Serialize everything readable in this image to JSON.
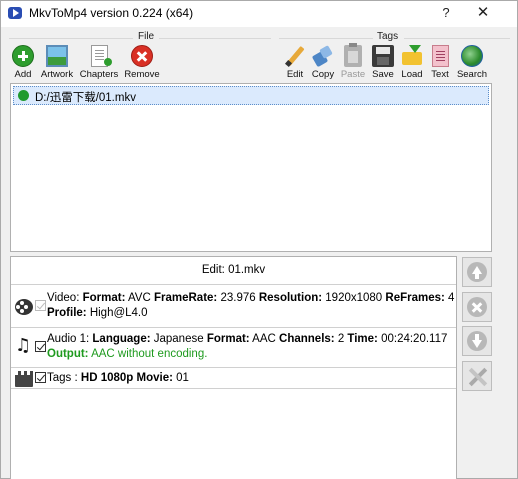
{
  "window": {
    "title": "MkvToMp4 version 0.224 (x64)",
    "help_label": "?",
    "close_label": "✕"
  },
  "toolbar": {
    "file_group_label": "File",
    "tags_group_label": "Tags",
    "add_label": "Add",
    "artwork_label": "Artwork",
    "chapters_label": "Chapters",
    "remove_label": "Remove",
    "edit_label": "Edit",
    "copy_label": "Copy",
    "paste_label": "Paste",
    "save_label": "Save",
    "load_label": "Load",
    "text_label": "Text",
    "search_label": "Search"
  },
  "file_list": {
    "items": [
      {
        "path": "D:/迅雷下载/01.mkv",
        "status_color": "#1f9a2f"
      }
    ]
  },
  "edit": {
    "title": "Edit: 01.mkv",
    "video": {
      "prefix": "Video: ",
      "format_key": "Format:",
      "format_val": " AVC ",
      "framerate_key": "FrameRate:",
      "framerate_val": " 23.976 ",
      "resolution_key": "Resolution:",
      "resolution_val": " 1920x1080 ",
      "reframes_key": "ReFrames:",
      "reframes_val": " 4",
      "profile_key": "Profile:",
      "profile_val": " High@L4.0",
      "checked": true,
      "enabled": false
    },
    "audio": {
      "prefix": "Audio 1: ",
      "language_key": "Language:",
      "language_val": " Japanese ",
      "format_key": "Format:",
      "format_val": " AAC ",
      "channels_key": "Channels:",
      "channels_val": " 2 ",
      "time_key": "Time:",
      "time_val": " 00:24:20.117",
      "output_key": "Output:",
      "output_val": " AAC without encoding.",
      "checked": true
    },
    "tags": {
      "prefix": "Tags : ",
      "hd_key": "HD 1080p",
      "movie_key": " Movie:",
      "movie_val": " 01",
      "checked": true
    }
  },
  "colors": {
    "output_green": "#1e9a1e",
    "selection_bg": "#dbeafd",
    "remove_red": "#d93025",
    "add_green": "#2e9d2e"
  }
}
